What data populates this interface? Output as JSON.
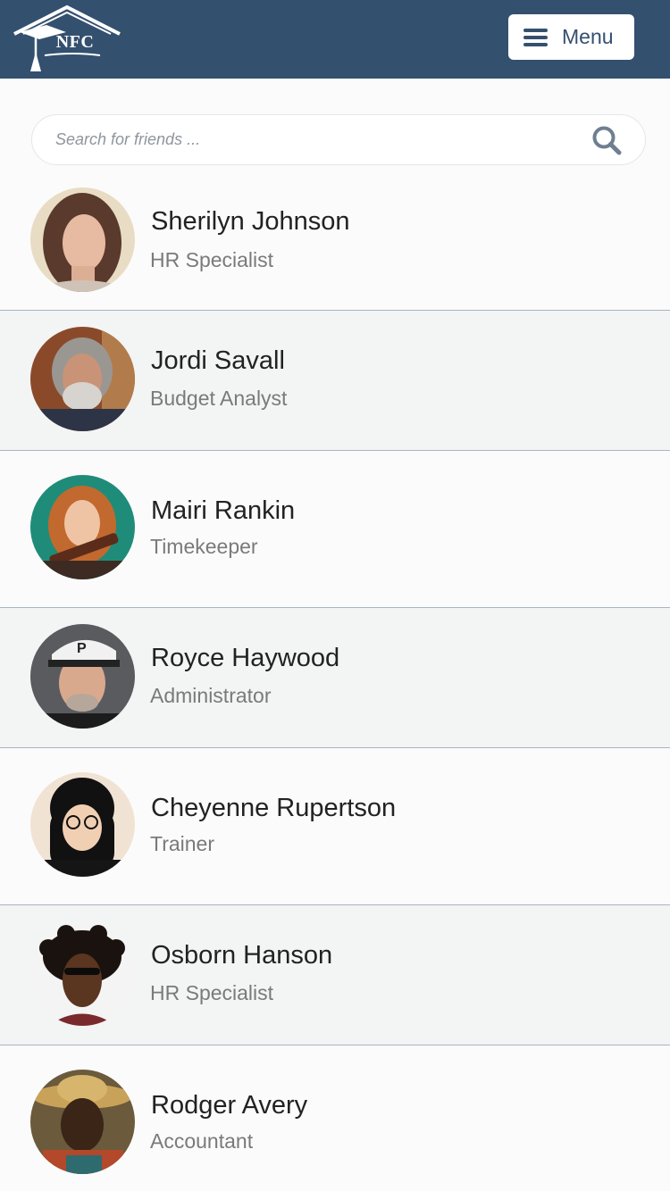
{
  "header": {
    "logo_text": "NFC",
    "menu_label": "Menu"
  },
  "search": {
    "placeholder": "Search for friends ...",
    "value": ""
  },
  "friends": [
    {
      "name": "Sherilyn Johnson",
      "title": "HR Specialist"
    },
    {
      "name": "Jordi Savall",
      "title": "Budget Analyst"
    },
    {
      "name": "Mairi Rankin",
      "title": "Timekeeper"
    },
    {
      "name": "Royce Haywood",
      "title": "Administrator"
    },
    {
      "name": "Cheyenne Rupertson",
      "title": "Trainer"
    },
    {
      "name": "Osborn Hanson",
      "title": "HR Specialist"
    },
    {
      "name": "Rodger Avery",
      "title": "Accountant"
    }
  ],
  "colors": {
    "header_bg": "#34506f",
    "page_bg": "#fbfbfb",
    "alt_row_bg": "#f3f4f4",
    "divider": "#a9b4c1",
    "name_text": "#222222",
    "title_text": "#7a7a7a"
  },
  "icons": {
    "logo": "graduation-house-logo",
    "menu": "hamburger-icon",
    "search": "search-icon"
  }
}
